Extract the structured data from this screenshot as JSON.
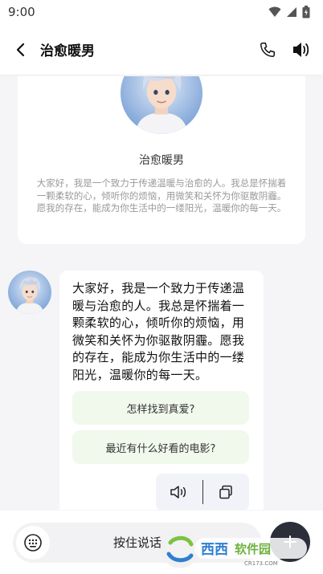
{
  "status": {
    "time": "9:00"
  },
  "header": {
    "title": "治愈暖男"
  },
  "profile": {
    "name": "治愈暖男",
    "intro": "大家好，我是一个致力于传递温暖与治愈的人。我总是怀揣着一颗柔软的心，倾听你的烦恼，用微笑和关怀为你驱散阴霾。愿我的存在，能成为你生活中的一缕阳光，温暖你的每一天。"
  },
  "message": {
    "text": "大家好，我是一个致力于传递温暖与治愈的人。我总是怀揣着一颗柔软的心，倾听你的烦恼，用微笑和关怀为你驱散阴霾。愿我的存在，能成为你生活中的一缕阳光，温暖你的每一天。",
    "suggestions": [
      "怎样找到真爱?",
      "最近有什么好看的电影?"
    ]
  },
  "input": {
    "hold_to_talk": "按住说话"
  },
  "watermark": {
    "brand": "西西",
    "sub": "软件园",
    "url": "CR173.COM"
  },
  "colors": {
    "suggestion_bg": "#f1f8ec",
    "send_button": "#2a2f3a",
    "hair": "#c9d3e6",
    "card_bg": "#ffffff",
    "page_bg": "#f5f5f7"
  }
}
